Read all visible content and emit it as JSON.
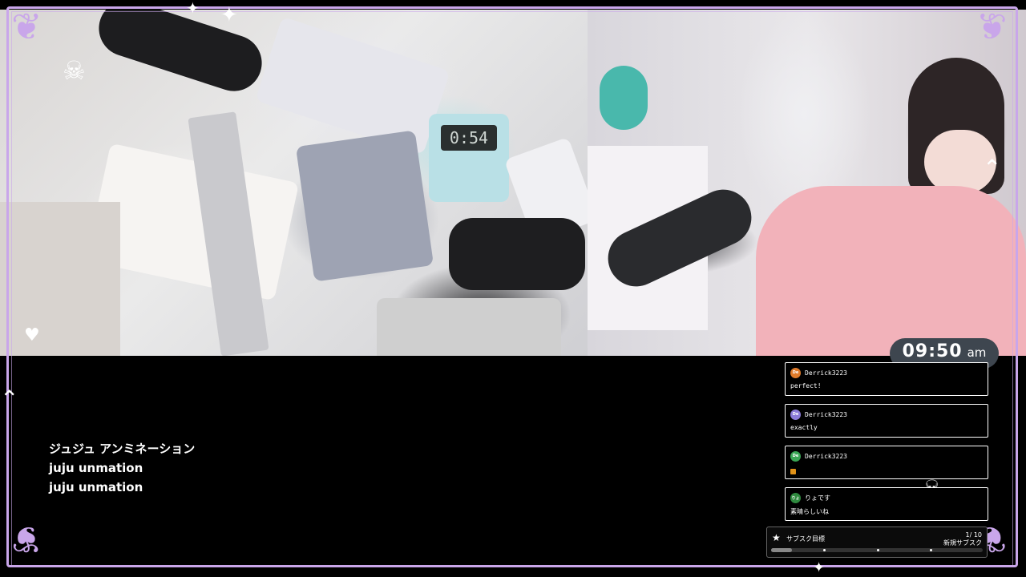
{
  "overlay": {
    "title_lines": [
      "ジュジュ アンミネーション",
      "juju unmation",
      "juju unmation"
    ],
    "clock": {
      "time": "09:50",
      "ampm": "am"
    },
    "timer_display": "0:54"
  },
  "chat": {
    "messages": [
      {
        "initials": "De",
        "avatar_color": "#e07b2a",
        "user": "Derrick3223",
        "text": "perfect!",
        "emote": false
      },
      {
        "initials": "De",
        "avatar_color": "#8b7bd8",
        "user": "Derrick3223",
        "text": "exactly",
        "emote": false
      },
      {
        "initials": "De",
        "avatar_color": "#3aa655",
        "user": "Derrick3223",
        "text": "",
        "emote": true
      },
      {
        "initials": "りょ",
        "avatar_color": "#2f8a3f",
        "user": "りょです",
        "text": "素晴らしいね",
        "emote": false
      }
    ]
  },
  "sub_goal": {
    "title": "サブスク目標",
    "count": "1/ 10",
    "subtitle": "新規サブスク",
    "progress": 0.1
  },
  "colors": {
    "frame": "#c9a6ea",
    "clock_bg": "#3e464f"
  }
}
